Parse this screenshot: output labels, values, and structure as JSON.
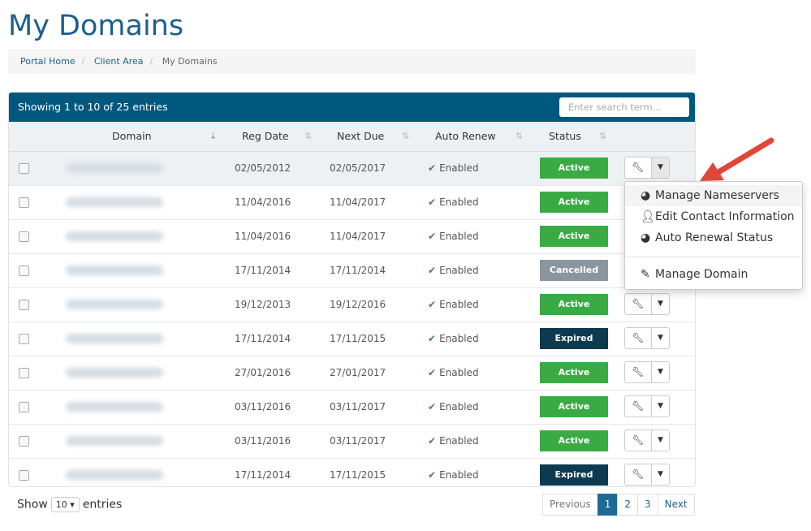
{
  "page": {
    "title": "My Domains"
  },
  "breadcrumb": [
    "Portal Home",
    "Client Area",
    "My Domains"
  ],
  "table": {
    "info": "Showing 1 to 10 of 25 entries",
    "search_placeholder": "Enter search term...",
    "columns": [
      "Domain",
      "Reg Date",
      "Next Due",
      "Auto Renew",
      "Status"
    ],
    "rows": [
      {
        "reg": "02/05/2012",
        "due": "02/05/2017",
        "renew": "Enabled",
        "status": "Active"
      },
      {
        "reg": "11/04/2016",
        "due": "11/04/2017",
        "renew": "Enabled",
        "status": "Active"
      },
      {
        "reg": "11/04/2016",
        "due": "11/04/2017",
        "renew": "Enabled",
        "status": "Active"
      },
      {
        "reg": "17/11/2014",
        "due": "17/11/2014",
        "renew": "Enabled",
        "status": "Cancelled"
      },
      {
        "reg": "19/12/2013",
        "due": "19/12/2016",
        "renew": "Enabled",
        "status": "Active"
      },
      {
        "reg": "17/11/2014",
        "due": "17/11/2015",
        "renew": "Enabled",
        "status": "Expired"
      },
      {
        "reg": "27/01/2016",
        "due": "27/01/2017",
        "renew": "Enabled",
        "status": "Active"
      },
      {
        "reg": "03/11/2016",
        "due": "03/11/2017",
        "renew": "Enabled",
        "status": "Active"
      },
      {
        "reg": "03/11/2016",
        "due": "03/11/2017",
        "renew": "Enabled",
        "status": "Active"
      },
      {
        "reg": "17/11/2014",
        "due": "17/11/2015",
        "renew": "Enabled",
        "status": "Expired"
      }
    ]
  },
  "status_colors": {
    "Active": "#3aaa45",
    "Cancelled": "#8a959f",
    "Expired": "#0d3a4e"
  },
  "dropdown": {
    "items": [
      {
        "label": "Manage Nameservers",
        "icon": "globe-icon"
      },
      {
        "label": "Edit Contact Information",
        "icon": "user-icon"
      },
      {
        "label": "Auto Renewal Status",
        "icon": "globe-icon"
      },
      {
        "label": "Manage Domain",
        "icon": "pencil-icon"
      }
    ]
  },
  "footer": {
    "show": "Show",
    "entries_value": "10",
    "entries": "entries"
  },
  "pagination": {
    "previous": "Previous",
    "pages": [
      "1",
      "2",
      "3"
    ],
    "active": "1",
    "next": "Next"
  },
  "annotation": {
    "arrow_color": "#e2463a"
  }
}
